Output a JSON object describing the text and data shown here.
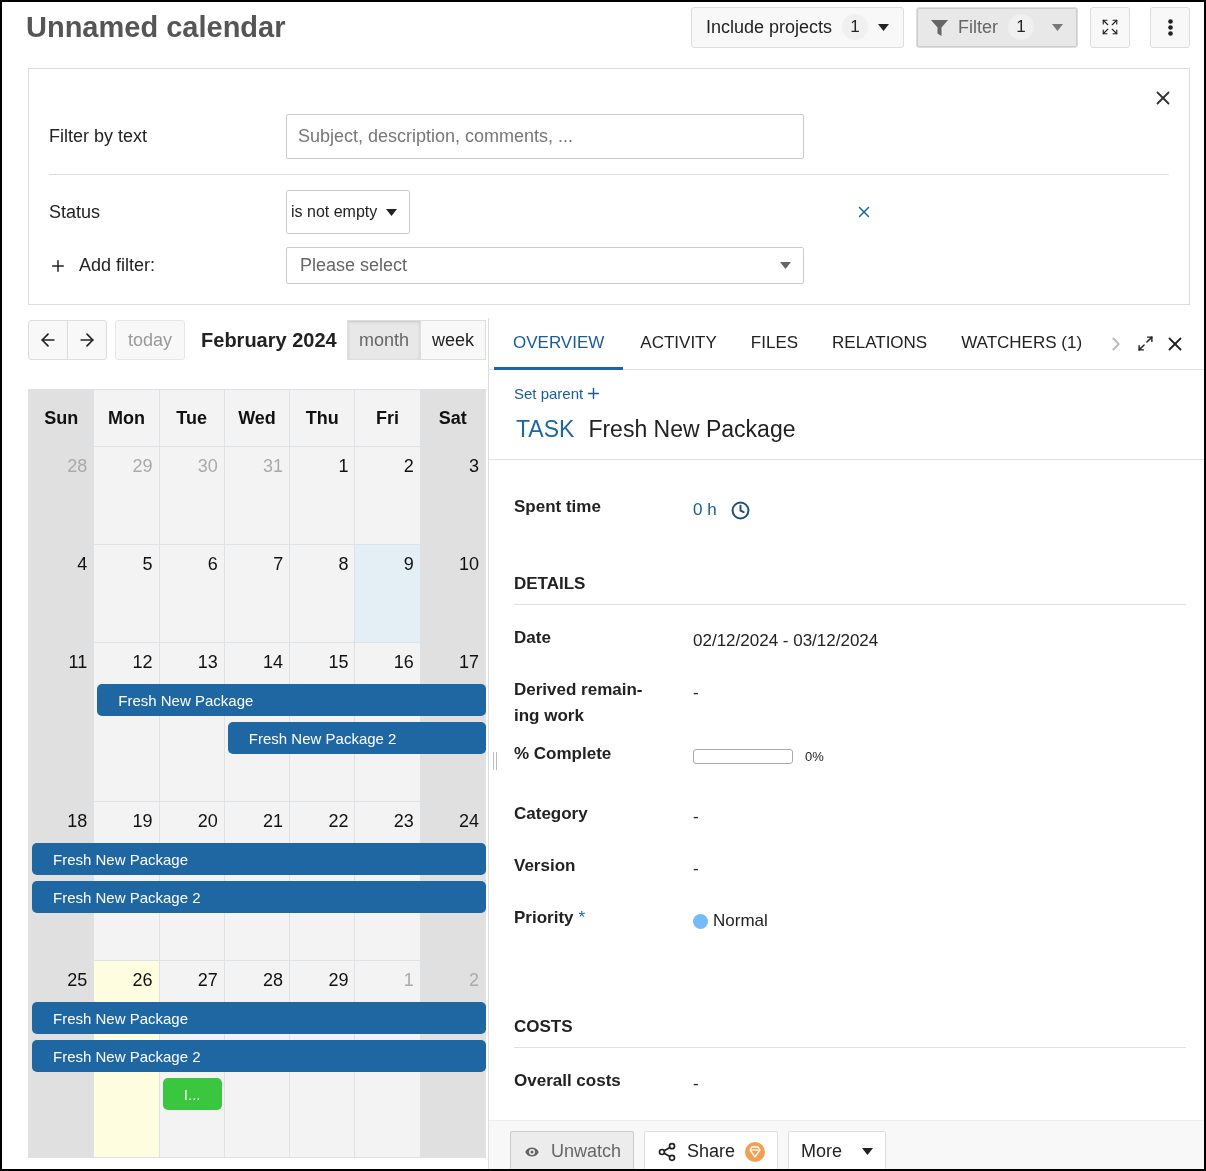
{
  "title": "Unnamed calendar",
  "toolbar": {
    "include_projects": {
      "label": "Include projects",
      "count": "1"
    },
    "filter": {
      "label": "Filter",
      "count": "1",
      "active": true
    }
  },
  "filter_panel": {
    "text_filter": {
      "label": "Filter by text",
      "placeholder": "Subject, description, comments, ..."
    },
    "filters": [
      {
        "label": "Status",
        "operator": "is not empty"
      }
    ],
    "add_filter": {
      "label": "Add filter:",
      "placeholder": "Please select"
    }
  },
  "calendar": {
    "title": "February 2024",
    "today_button": {
      "label": "today",
      "disabled": true
    },
    "views": [
      {
        "label": "month",
        "selected": true
      },
      {
        "label": "week",
        "selected": false
      }
    ],
    "weekdays": [
      {
        "label": "Sun",
        "weekend": true
      },
      {
        "label": "Mon",
        "weekend": false
      },
      {
        "label": "Tue",
        "weekend": false
      },
      {
        "label": "Wed",
        "weekend": false
      },
      {
        "label": "Thu",
        "weekend": false
      },
      {
        "label": "Fri",
        "weekend": false
      },
      {
        "label": "Sat",
        "weekend": true
      }
    ],
    "weeks": [
      {
        "days": [
          {
            "label": "28",
            "other_month": true,
            "today": false,
            "highlighted": false
          },
          {
            "label": "29",
            "other_month": true,
            "today": false,
            "highlighted": false
          },
          {
            "label": "30",
            "other_month": true,
            "today": false,
            "highlighted": false
          },
          {
            "label": "31",
            "other_month": true,
            "today": false,
            "highlighted": false
          },
          {
            "label": "1",
            "other_month": false,
            "today": false,
            "highlighted": false
          },
          {
            "label": "2",
            "other_month": false,
            "today": false,
            "highlighted": false
          },
          {
            "label": "3",
            "other_month": false,
            "today": false,
            "highlighted": false
          }
        ]
      },
      {
        "days": [
          {
            "label": "4",
            "other_month": false,
            "today": false,
            "highlighted": false
          },
          {
            "label": "5",
            "other_month": false,
            "today": false,
            "highlighted": false
          },
          {
            "label": "6",
            "other_month": false,
            "today": false,
            "highlighted": false
          },
          {
            "label": "7",
            "other_month": false,
            "today": false,
            "highlighted": false
          },
          {
            "label": "8",
            "other_month": false,
            "today": false,
            "highlighted": false
          },
          {
            "label": "9",
            "other_month": false,
            "today": false,
            "highlighted": true
          },
          {
            "label": "10",
            "other_month": false,
            "today": false,
            "highlighted": false
          }
        ]
      },
      {
        "days": [
          {
            "label": "11",
            "other_month": false,
            "today": false,
            "highlighted": false
          },
          {
            "label": "12",
            "other_month": false,
            "today": false,
            "highlighted": false
          },
          {
            "label": "13",
            "other_month": false,
            "today": false,
            "highlighted": false
          },
          {
            "label": "14",
            "other_month": false,
            "today": false,
            "highlighted": false
          },
          {
            "label": "15",
            "other_month": false,
            "today": false,
            "highlighted": false
          },
          {
            "label": "16",
            "other_month": false,
            "today": false,
            "highlighted": false
          },
          {
            "label": "17",
            "other_month": false,
            "today": false,
            "highlighted": false
          }
        ],
        "events": [
          {
            "title": "Fresh New Package",
            "color": "#1e67a3"
          },
          {
            "title": "Fresh New Package 2",
            "color": "#1e67a3"
          }
        ]
      },
      {
        "days": [
          {
            "label": "18",
            "other_month": false,
            "today": false,
            "highlighted": false
          },
          {
            "label": "19",
            "other_month": false,
            "today": false,
            "highlighted": false
          },
          {
            "label": "20",
            "other_month": false,
            "today": false,
            "highlighted": false
          },
          {
            "label": "21",
            "other_month": false,
            "today": false,
            "highlighted": false
          },
          {
            "label": "22",
            "other_month": false,
            "today": false,
            "highlighted": false
          },
          {
            "label": "23",
            "other_month": false,
            "today": false,
            "highlighted": false
          },
          {
            "label": "24",
            "other_month": false,
            "today": false,
            "highlighted": false
          }
        ],
        "events": [
          {
            "title": "Fresh New Package",
            "color": "#1e67a3"
          },
          {
            "title": "Fresh New Package 2",
            "color": "#1e67a3"
          }
        ]
      },
      {
        "days": [
          {
            "label": "25",
            "other_month": false,
            "today": false,
            "highlighted": false
          },
          {
            "label": "26",
            "other_month": false,
            "today": true,
            "highlighted": false
          },
          {
            "label": "27",
            "other_month": false,
            "today": false,
            "highlighted": false
          },
          {
            "label": "28",
            "other_month": false,
            "today": false,
            "highlighted": false
          },
          {
            "label": "29",
            "other_month": false,
            "today": false,
            "highlighted": false
          },
          {
            "label": "1",
            "other_month": true,
            "today": false,
            "highlighted": false
          },
          {
            "label": "2",
            "other_month": true,
            "today": false,
            "highlighted": false
          }
        ],
        "events": [
          {
            "title": "Fresh New Package",
            "color": "#1e67a3"
          },
          {
            "title": "Fresh New Package 2",
            "color": "#1e67a3"
          },
          {
            "title": "I...",
            "color": "#3bc63f"
          }
        ]
      }
    ]
  },
  "details": {
    "tabs": [
      {
        "label": "OVERVIEW",
        "selected": true
      },
      {
        "label": "ACTIVITY",
        "selected": false
      },
      {
        "label": "FILES",
        "selected": false
      },
      {
        "label": "RELATIONS",
        "selected": false
      },
      {
        "label": "WATCHERS (1)",
        "selected": false
      }
    ],
    "set_parent": "Set parent",
    "type": "TASK",
    "subject": "Fresh New Package",
    "spent_time": {
      "label": "Spent time",
      "value": "0 h"
    },
    "sections": [
      {
        "title": "DETAILS",
        "fields": [
          {
            "kind": "text",
            "label": "Date",
            "value": "02/12/2024 - 03/12/2024"
          },
          {
            "kind": "text",
            "label": "Derived remain-ing work",
            "value": "-"
          },
          {
            "kind": "progress",
            "label": "% Complete",
            "level": 0,
            "reading": "0%"
          },
          {
            "kind": "text",
            "label": "Category",
            "value": "-"
          },
          {
            "kind": "text",
            "label": "Version",
            "value": "-"
          },
          {
            "kind": "priority",
            "label": "Priority",
            "required_mark": "*",
            "value": "Normal",
            "color": "#74bbfb"
          }
        ]
      },
      {
        "title": "COSTS",
        "fields": [
          {
            "kind": "text",
            "label": "Overall costs",
            "value": "-"
          }
        ]
      }
    ],
    "actions": [
      {
        "kind": "watch",
        "label": "Unwatch"
      },
      {
        "kind": "share",
        "label": "Share"
      },
      {
        "kind": "more",
        "label": "More"
      }
    ]
  }
}
